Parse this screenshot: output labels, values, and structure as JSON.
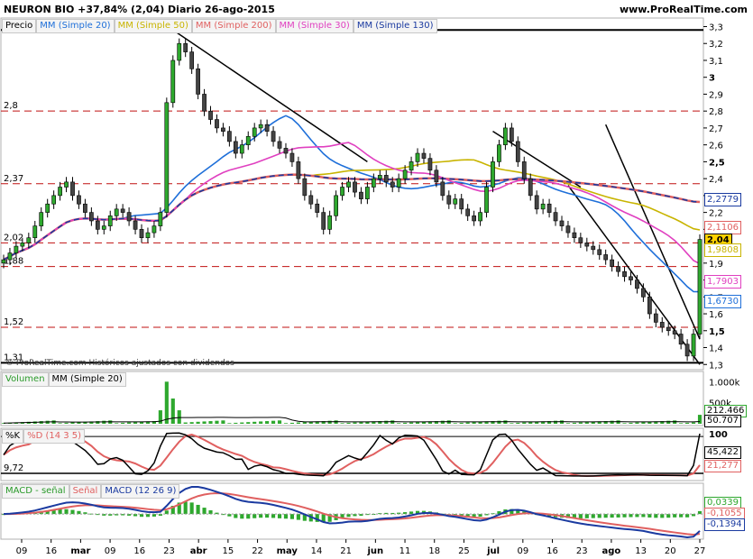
{
  "header": {
    "title": "NEURON BIO  +37,84% (2,04)  Diario  26-ago-2015",
    "site": "www.ProRealTime.com"
  },
  "price_panel": {
    "legend": [
      {
        "label": "Precio",
        "color": "#000000"
      },
      {
        "label": "MM (Simple 20)",
        "color": "#1e6fd9"
      },
      {
        "label": "MM (Simple 50)",
        "color": "#c8b400"
      },
      {
        "label": "MM (Simple 200)",
        "color": "#e06060"
      },
      {
        "label": "MM (Simple 30)",
        "color": "#e040c0"
      },
      {
        "label": "MM (Simple 130)",
        "color": "#1a3aa0"
      }
    ],
    "copyright": "© ProRealTime.com Históricos ajustados con dividendos",
    "level_labels": [
      "3,28",
      "2,8",
      "2,37",
      "2,02",
      "1,88",
      "1,52",
      "1,31"
    ],
    "axis_ticks": [
      "3,3",
      "3,2",
      "3,1",
      "3",
      "2,9",
      "2,8",
      "2,7",
      "2,6",
      "2,5",
      "2,4",
      "2,3",
      "2,2",
      "2,1",
      "1,9",
      "1,8",
      "1,7",
      "1,6",
      "1,5",
      "1,4",
      "1,3"
    ],
    "value_boxes": [
      {
        "text": "2,2779",
        "color": "#1a3aa0"
      },
      {
        "text": "2,1106",
        "color": "#e06060"
      },
      {
        "text": "2,04",
        "color": "#000000"
      },
      {
        "text": "1,9808",
        "color": "#c8b400"
      },
      {
        "text": "1,7903",
        "color": "#e040c0"
      },
      {
        "text": "1,6730",
        "color": "#1e6fd9"
      }
    ]
  },
  "volume_panel": {
    "legend": [
      "Volumen",
      "MM (Simple 20)"
    ],
    "axis_ticks": [
      "1.000k",
      "500k"
    ],
    "value_boxes": [
      "212.466",
      "50.707"
    ]
  },
  "stoch_panel": {
    "legend": [
      "%K",
      "%D (14 3 5)"
    ],
    "axis_ticks": [
      "100"
    ],
    "level_label": "9,72",
    "value_boxes": [
      "45,422",
      "21,277"
    ]
  },
  "macd_panel": {
    "legend": [
      "MACD - señal",
      "Señal",
      "MACD (12 26 9)"
    ],
    "value_boxes": [
      "0,0339",
      "-0,1055",
      "-0,1394"
    ]
  },
  "x_axis": {
    "labels": [
      "09",
      "16",
      "mar",
      "09",
      "16",
      "23",
      "abr",
      "15",
      "22",
      "may",
      "14",
      "21",
      "jun",
      "11",
      "18",
      "25",
      "jul",
      "09",
      "16",
      "23",
      "ago",
      "13",
      "20",
      "27"
    ]
  },
  "chart_data": {
    "type": "candlestick",
    "title": "NEURON BIO  +37,84% (2,04)  Diario  26-ago-2015",
    "last_close": 2.04,
    "change_percent": 37.84,
    "y_range": [
      1.28,
      3.34
    ],
    "horizontal_levels": [
      3.28,
      2.8,
      2.37,
      2.02,
      1.88,
      1.52,
      1.31
    ],
    "x_labels": [
      "09",
      "16",
      "mar",
      "09",
      "16",
      "23",
      "abr",
      "15",
      "22",
      "may",
      "14",
      "21",
      "jun",
      "11",
      "18",
      "25",
      "jul",
      "09",
      "16",
      "23",
      "ago",
      "13",
      "20",
      "27"
    ],
    "close_series": [
      1.92,
      1.96,
      2.0,
      2.02,
      2.05,
      2.12,
      2.2,
      2.25,
      2.3,
      2.35,
      2.38,
      2.3,
      2.25,
      2.2,
      2.15,
      2.1,
      2.12,
      2.18,
      2.22,
      2.2,
      2.15,
      2.1,
      2.05,
      2.08,
      2.12,
      2.2,
      2.85,
      3.1,
      3.2,
      3.15,
      3.05,
      2.9,
      2.8,
      2.75,
      2.7,
      2.68,
      2.62,
      2.55,
      2.6,
      2.65,
      2.7,
      2.72,
      2.68,
      2.62,
      2.58,
      2.55,
      2.5,
      2.4,
      2.3,
      2.25,
      2.2,
      2.1,
      2.18,
      2.3,
      2.35,
      2.38,
      2.32,
      2.28,
      2.35,
      2.4,
      2.42,
      2.38,
      2.35,
      2.4,
      2.45,
      2.5,
      2.55,
      2.52,
      2.45,
      2.38,
      2.3,
      2.25,
      2.28,
      2.22,
      2.18,
      2.15,
      2.2,
      2.35,
      2.5,
      2.6,
      2.7,
      2.62,
      2.5,
      2.4,
      2.3,
      2.22,
      2.25,
      2.2,
      2.15,
      2.12,
      2.08,
      2.05,
      2.02,
      2.0,
      1.98,
      1.95,
      1.92,
      1.88,
      1.85,
      1.82,
      1.8,
      1.75,
      1.7,
      1.6,
      1.55,
      1.52,
      1.5,
      1.48,
      1.42,
      1.35,
      1.48,
      2.04
    ],
    "series": [
      {
        "name": "MM (Simple 20)",
        "last": 1.673
      },
      {
        "name": "MM (Simple 50)",
        "last": 1.9808
      },
      {
        "name": "MM (Simple 200)",
        "last": 2.1106
      },
      {
        "name": "MM (Simple 30)",
        "last": 1.7903
      },
      {
        "name": "MM (Simple 130)",
        "last": 2.2779
      }
    ],
    "volume": {
      "last": 212466,
      "ma20": 50707
    },
    "stochastic": {
      "k": 45.422,
      "d": 21.277
    },
    "macd": {
      "histogram": 0.0339,
      "signal": -0.1055,
      "macd": -0.1394
    }
  }
}
